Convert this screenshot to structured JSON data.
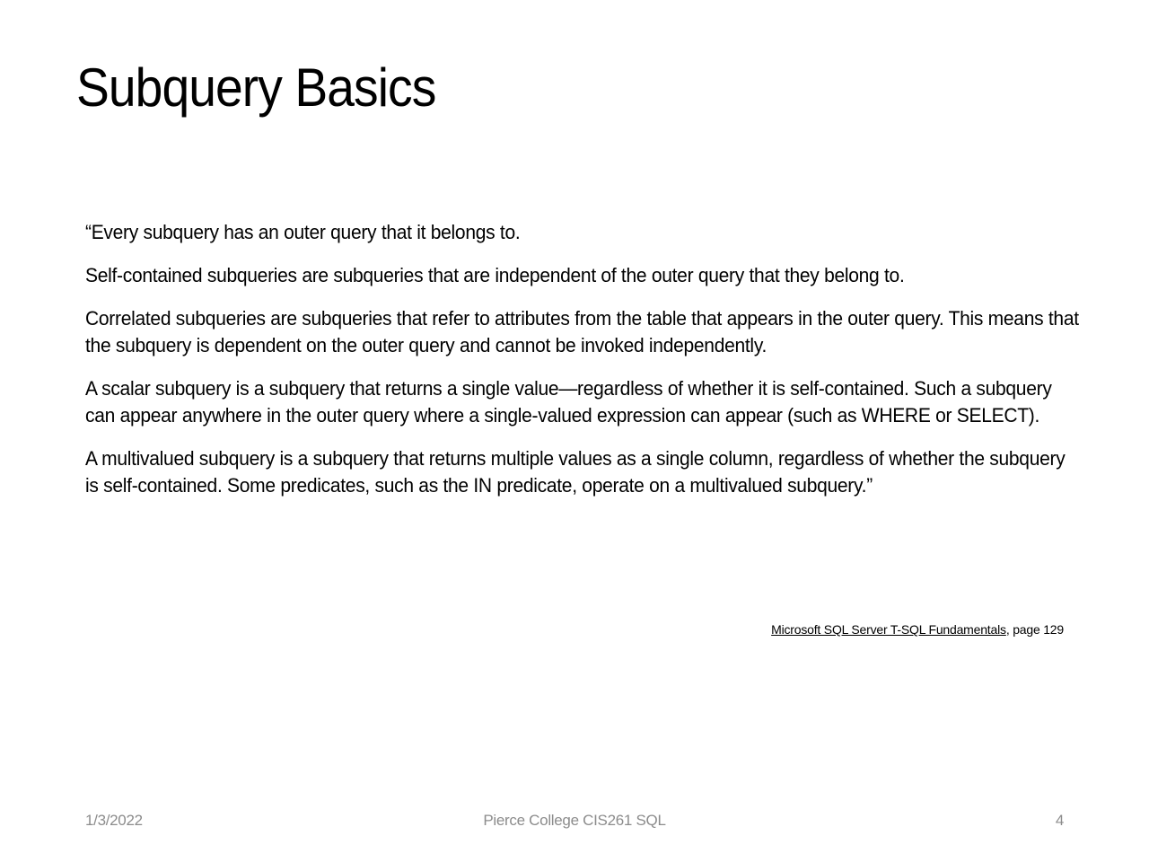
{
  "slide": {
    "title": "Subquery Basics",
    "paragraphs": [
      "“Every subquery has an outer query that it belongs to.",
      "Self-contained subqueries are subqueries that are independent of the outer query that they belong to.",
      "Correlated subqueries are subqueries that refer to attributes from the table that appears in the outer query. This means that the subquery is dependent on the outer query and cannot be invoked independently.",
      "A scalar subquery is a subquery that returns a single value—regardless of whether it is self-contained. Such a subquery can appear anywhere in the outer query where a single-valued expression can appear (such as WHERE or SELECT).",
      "A multivalued subquery is a subquery that returns multiple values as a single column, regardless of whether the subquery is self-contained. Some predicates, such as the IN predicate, operate on a multivalued subquery.”"
    ],
    "citation": {
      "source": "Microsoft SQL Server T-SQL Fundamentals",
      "rest": ", page 129"
    }
  },
  "footer": {
    "date": "1/3/2022",
    "center": "Pierce College CIS261 SQL",
    "page_number": "4"
  }
}
